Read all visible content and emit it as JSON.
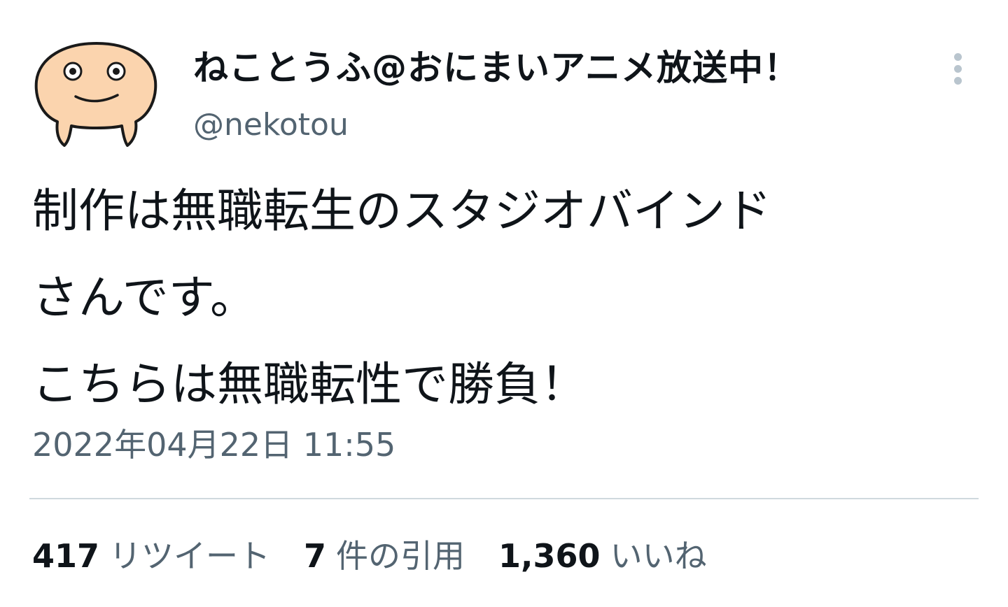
{
  "user": {
    "display_name": "ねことうふ@おにまいアニメ放送中！",
    "handle": "@nekotou",
    "avatar_icon": "cartoon-face-avatar",
    "avatar_color": "#fbd4ae"
  },
  "tweet": {
    "lines": [
      "制作は無職転生のスタジオバインド",
      "さんです。",
      "こちらは無職転性で勝負！"
    ],
    "timestamp": "2022年04月22日 11:55"
  },
  "stats": {
    "retweets": {
      "count": "417",
      "label": "リツイート"
    },
    "quotes": {
      "count": "7",
      "label": "件の引用"
    },
    "likes": {
      "count": "1,360",
      "label": "いいね"
    }
  },
  "menu": {
    "more_icon": "more-vertical-icon"
  },
  "colors": {
    "text_primary": "#0f1419",
    "text_secondary": "#536471",
    "divider": "#cfd9de",
    "more_dots": "#b9c5ce"
  }
}
